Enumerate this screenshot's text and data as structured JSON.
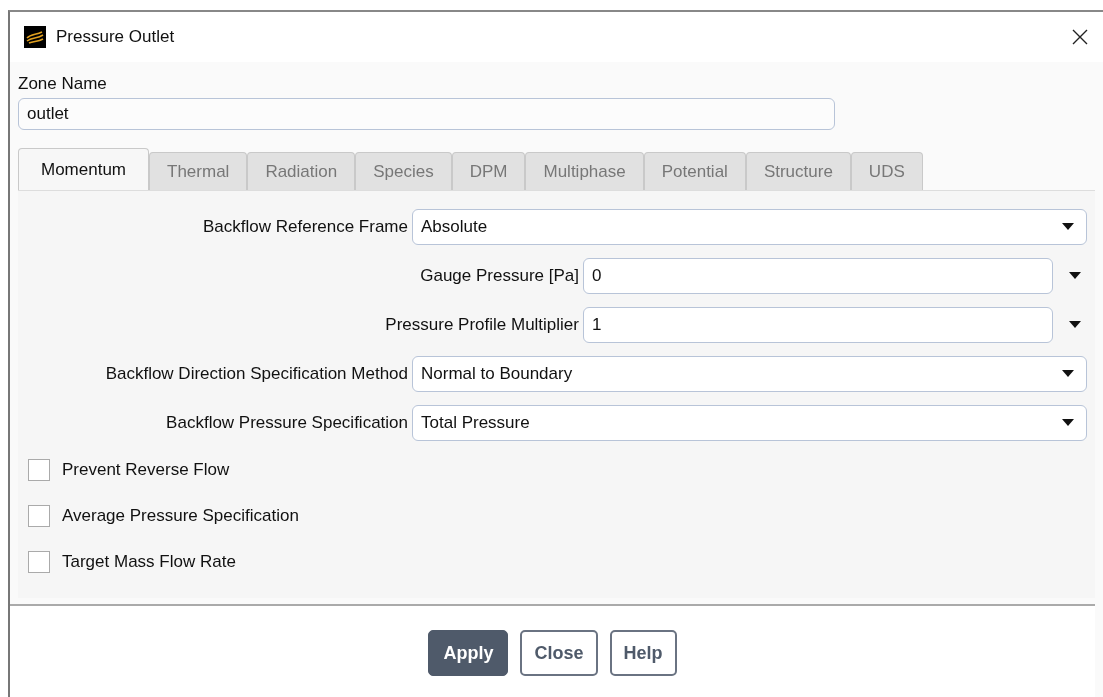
{
  "window": {
    "title": "Pressure Outlet"
  },
  "zone_name": {
    "label": "Zone Name",
    "value": "outlet"
  },
  "tabs": [
    {
      "label": "Momentum",
      "selected": true
    },
    {
      "label": "Thermal",
      "selected": false
    },
    {
      "label": "Radiation",
      "selected": false
    },
    {
      "label": "Species",
      "selected": false
    },
    {
      "label": "DPM",
      "selected": false
    },
    {
      "label": "Multiphase",
      "selected": false
    },
    {
      "label": "Potential",
      "selected": false
    },
    {
      "label": "Structure",
      "selected": false
    },
    {
      "label": "UDS",
      "selected": false
    }
  ],
  "fields": [
    {
      "kind": "dropdown",
      "label": "Backflow Reference Frame",
      "value": "Absolute"
    },
    {
      "kind": "expression",
      "label": "Gauge Pressure [Pa]",
      "value": "0"
    },
    {
      "kind": "expression",
      "label": "Pressure Profile Multiplier",
      "value": "1"
    },
    {
      "kind": "dropdown",
      "label": "Backflow Direction Specification Method",
      "value": "Normal to Boundary"
    },
    {
      "kind": "dropdown",
      "label": "Backflow Pressure Specification",
      "value": "Total Pressure"
    }
  ],
  "checkboxes": [
    {
      "label": "Prevent Reverse Flow",
      "checked": false
    },
    {
      "label": "Average Pressure Specification",
      "checked": false
    },
    {
      "label": "Target Mass Flow Rate",
      "checked": false
    }
  ],
  "buttons": [
    {
      "label": "Apply",
      "kind": "primary"
    },
    {
      "label": "Close",
      "kind": "secondary"
    },
    {
      "label": "Help",
      "kind": "secondary"
    }
  ]
}
